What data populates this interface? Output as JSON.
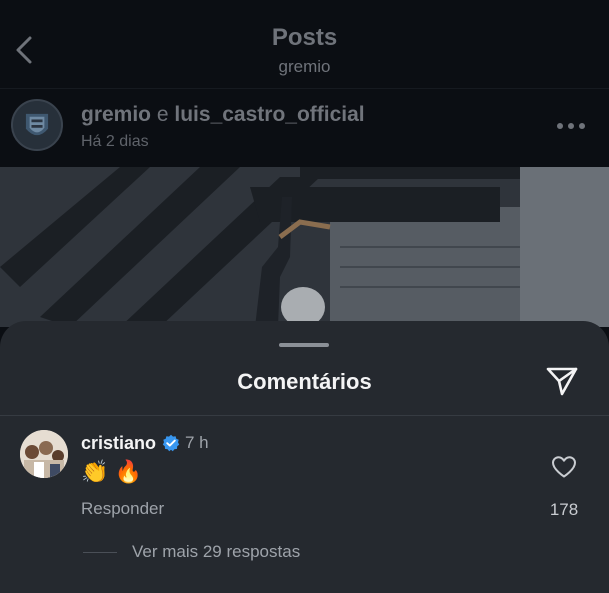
{
  "header": {
    "title": "Posts",
    "subtitle": "gremio"
  },
  "post": {
    "user1": "gremio",
    "conjunction": "e",
    "user2": "luis_castro_official",
    "time": "Há 2 dias"
  },
  "sheet": {
    "title": "Comentários"
  },
  "comment": {
    "username": "cristiano",
    "verified": true,
    "time": "7 h",
    "text": "👏 🔥",
    "reply_label": "Responder",
    "likes": "178",
    "more_replies": "Ver mais 29 respostas"
  },
  "colors": {
    "sheet_bg": "#25292f",
    "verified_blue": "#3897f0",
    "fire": "#f25c05"
  }
}
